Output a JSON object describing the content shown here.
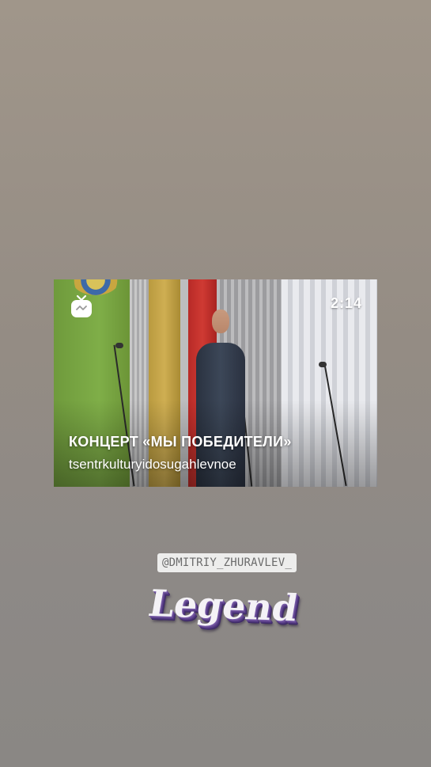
{
  "post": {
    "duration": "2:14",
    "title": "КОНЦЕРТ «МЫ ПОБЕДИТЕЛИ»",
    "channel": "tsentrkulturyidosugahlevnoe"
  },
  "mention": "@DMITRIY_ZHURAVLEV_",
  "sticker": "Legend",
  "icons": {
    "igtv": "igtv-icon"
  }
}
